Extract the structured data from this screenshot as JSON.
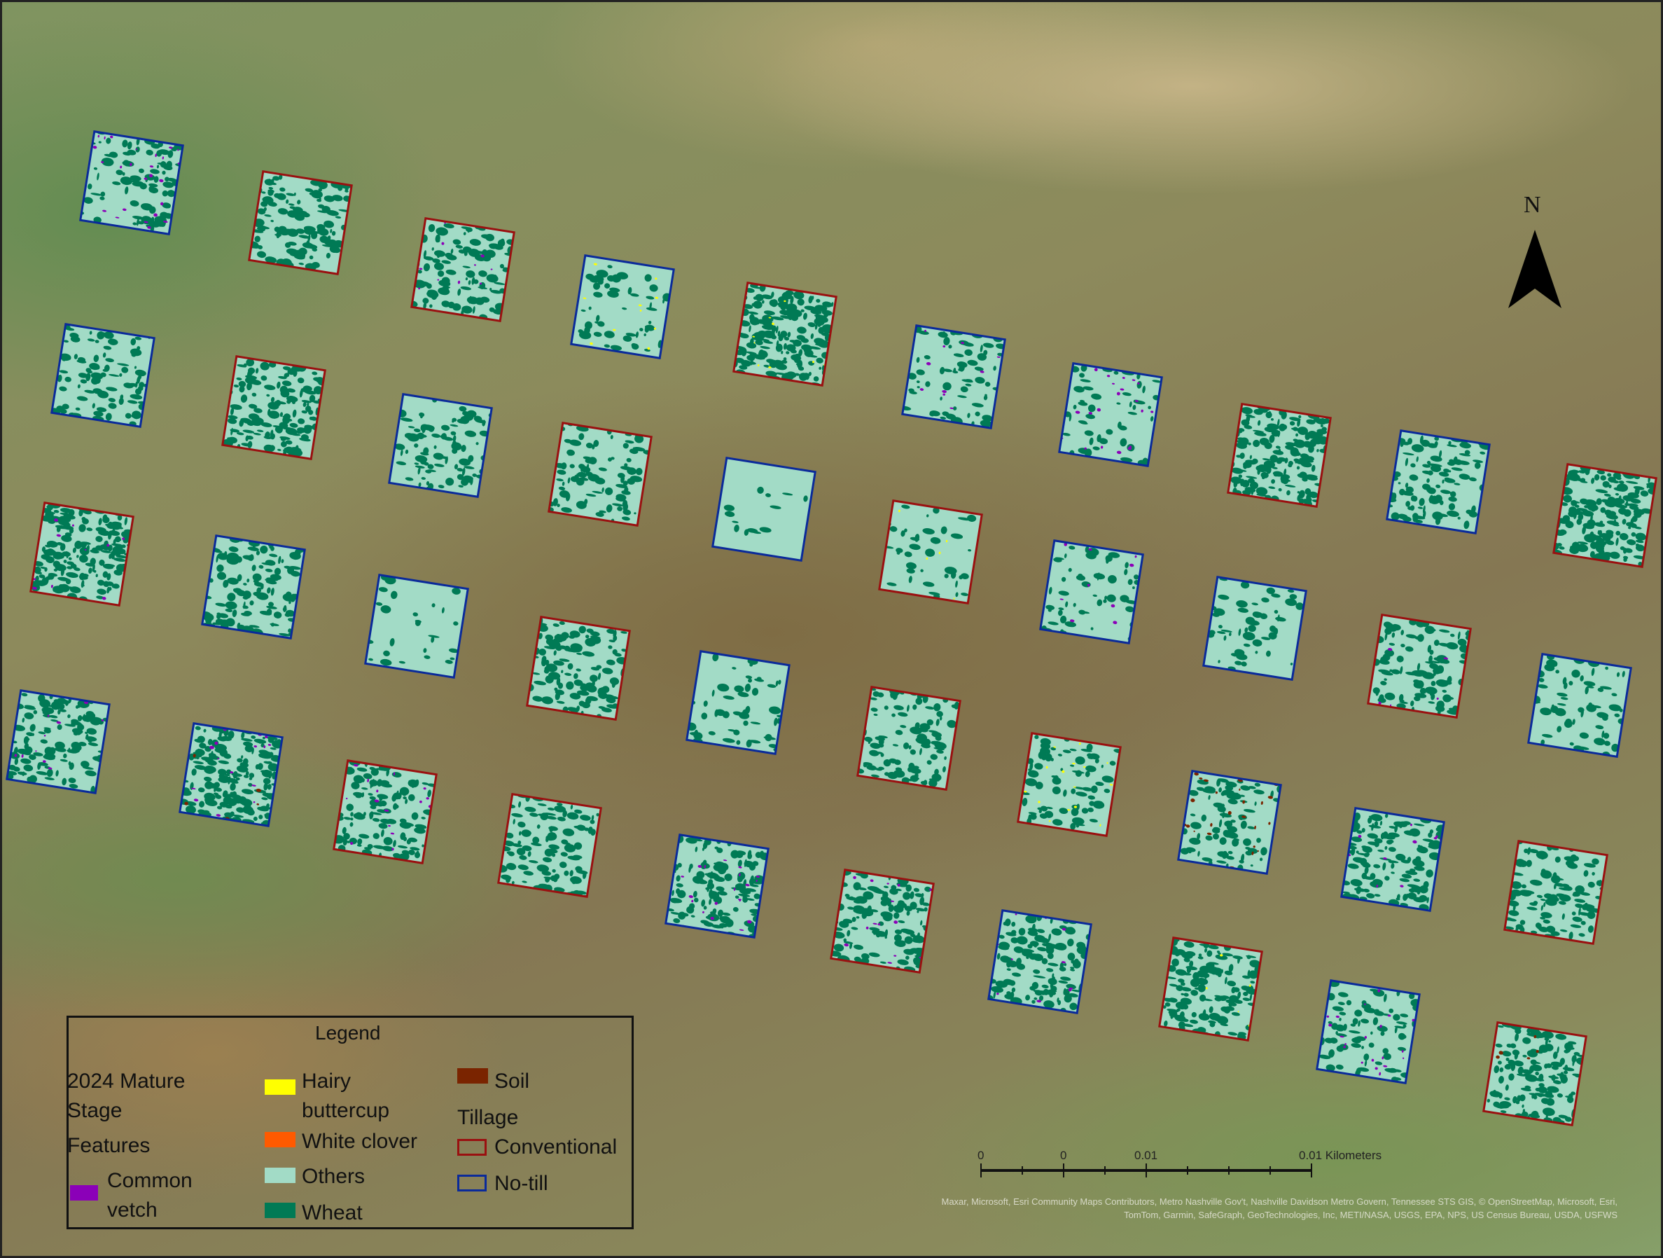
{
  "legend": {
    "title": "Legend",
    "group_title_line1": "2024 Mature",
    "group_title_line2": "Stage",
    "group_title_line3": "Features",
    "classes": [
      {
        "label_line1": "Common",
        "label_line2": "vetch",
        "color": "#8b00b8"
      },
      {
        "label_line1": "Hairy",
        "label_line2": "buttercup",
        "color": "#ffff00"
      },
      {
        "label_line1": "White clover",
        "color": "#ff5a00"
      },
      {
        "label_line1": "Others",
        "color": "#a2dbc6"
      },
      {
        "label_line1": "Wheat",
        "color": "#007a55"
      },
      {
        "label_line1": "Soil",
        "color": "#7a2400"
      }
    ],
    "tillage_title": "Tillage",
    "tillage": [
      {
        "label": "Conventional",
        "color": "#9a1010"
      },
      {
        "label": "No-till",
        "color": "#0a2a9a"
      }
    ]
  },
  "north_arrow": {
    "label": "N"
  },
  "scale_bar": {
    "labels": [
      "0",
      "0",
      "0.01",
      "0.01 Kilometers"
    ]
  },
  "attribution": {
    "line1": "Maxar, Microsoft, Esri Community Maps Contributors, Metro Nashville Gov't, Nashville Davidson Metro Govern, Tennessee STS GIS, © OpenStreetMap, Microsoft, Esri,",
    "line2": "TomTom, Garmin, SafeGraph, GeoTechnologies, Inc, METI/NASA, USGS, EPA, NPS, US Census Bureau, USDA, USFWS"
  },
  "plots": [
    {
      "tillage": "No-till",
      "wheat": 0.35,
      "vetch": 0.05
    },
    {
      "tillage": "Conventional",
      "wheat": 0.5
    },
    {
      "tillage": "Conventional",
      "wheat": 0.4,
      "vetch": 0.02
    },
    {
      "tillage": "No-till",
      "wheat": 0.2,
      "buttercup": 0.02
    },
    {
      "tillage": "Conventional",
      "wheat": 0.7,
      "buttercup": 0.02
    },
    {
      "tillage": "No-till",
      "wheat": 0.25,
      "vetch": 0.02
    },
    {
      "tillage": "No-till",
      "wheat": 0.2,
      "vetch": 0.04
    },
    {
      "tillage": "Conventional",
      "wheat": 0.65
    },
    {
      "tillage": "No-till",
      "wheat": 0.4
    },
    {
      "tillage": "Conventional",
      "wheat": 0.65
    },
    {
      "tillage": "No-till",
      "wheat": 0.35
    },
    {
      "tillage": "Conventional",
      "wheat": 0.55
    },
    {
      "tillage": "No-till",
      "wheat": 0.35
    },
    {
      "tillage": "Conventional",
      "wheat": 0.35
    },
    {
      "tillage": "No-till",
      "wheat": 0.05
    },
    {
      "tillage": "Conventional",
      "wheat": 0.15,
      "buttercup": 0.01
    },
    {
      "tillage": "No-till",
      "wheat": 0.2,
      "vetch": 0.02
    },
    {
      "tillage": "No-till",
      "wheat": 0.2
    },
    {
      "tillage": "Conventional",
      "wheat": 0.4,
      "vetch": 0.01
    },
    {
      "tillage": "No-till",
      "wheat": 0.25
    },
    {
      "tillage": "Conventional",
      "wheat": 0.7,
      "vetch": 0.02
    },
    {
      "tillage": "No-till",
      "wheat": 0.45
    },
    {
      "tillage": "No-till",
      "wheat": 0.1
    },
    {
      "tillage": "Conventional",
      "wheat": 0.45
    },
    {
      "tillage": "No-till",
      "wheat": 0.2
    },
    {
      "tillage": "Conventional",
      "wheat": 0.4
    },
    {
      "tillage": "Conventional",
      "wheat": 0.3,
      "buttercup": 0.03
    },
    {
      "tillage": "No-till",
      "wheat": 0.35,
      "soil": 0.05
    },
    {
      "tillage": "No-till",
      "wheat": 0.5,
      "vetch": 0.02
    },
    {
      "tillage": "Conventional",
      "wheat": 0.4
    },
    {
      "tillage": "No-till",
      "wheat": 0.5,
      "vetch": 0.02
    },
    {
      "tillage": "No-till",
      "wheat": 0.7,
      "vetch": 0.03,
      "soil": 0.01
    },
    {
      "tillage": "Conventional",
      "wheat": 0.45,
      "vetch": 0.03
    },
    {
      "tillage": "Conventional",
      "wheat": 0.4
    },
    {
      "tillage": "No-till",
      "wheat": 0.5,
      "vetch": 0.04
    },
    {
      "tillage": "Conventional",
      "wheat": 0.45,
      "vetch": 0.03
    },
    {
      "tillage": "No-till",
      "wheat": 0.5,
      "vetch": 0.02
    },
    {
      "tillage": "Conventional",
      "wheat": 0.55,
      "buttercup": 0.01
    },
    {
      "tillage": "No-till",
      "wheat": 0.3,
      "vetch": 0.04
    },
    {
      "tillage": "Conventional",
      "wheat": 0.55,
      "soil": 0.01
    }
  ]
}
